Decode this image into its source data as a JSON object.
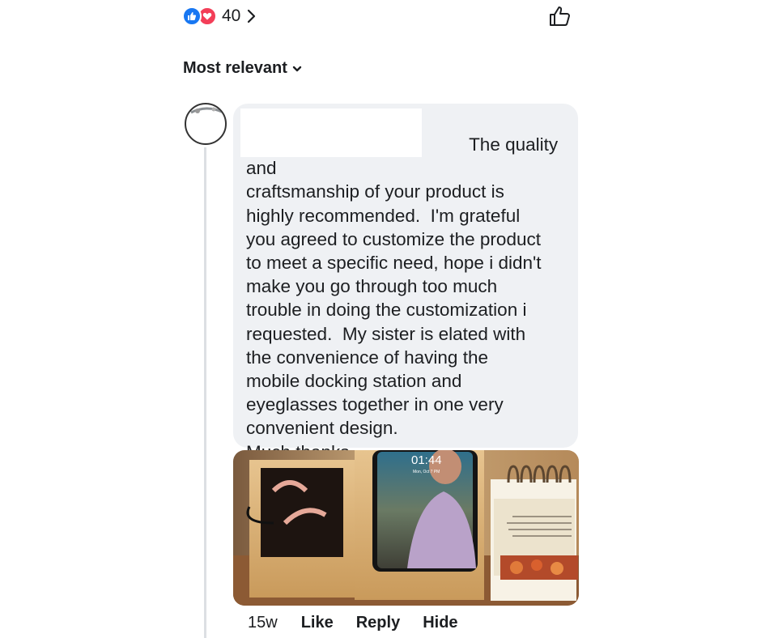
{
  "reactions": {
    "types": [
      "like-icon",
      "love-icon"
    ],
    "count": "40",
    "like_color": "#1877f2",
    "love_color": "#f33e58"
  },
  "sort": {
    "label": "Most relevant"
  },
  "comment": {
    "text": "                                            The quality and\ncraftsmanship of your product is\nhighly recommended.  I'm grateful\nyou agreed to customize the product\nto meet a specific need, hope i didn't\nmake you go through too much\ntrouble in doing the customization i\nrequested.  My sister is elated with\nthe convenience of having the\nmobile docking station and\neyeglasses together in one very\nconvenient design.\nMuch thanks.",
    "photo": {
      "phone_time": "01:44",
      "phone_date": "Mon, Oct 7  PM"
    },
    "timestamp": "15w",
    "actions": {
      "like": "Like",
      "reply": "Reply",
      "hide": "Hide"
    }
  }
}
